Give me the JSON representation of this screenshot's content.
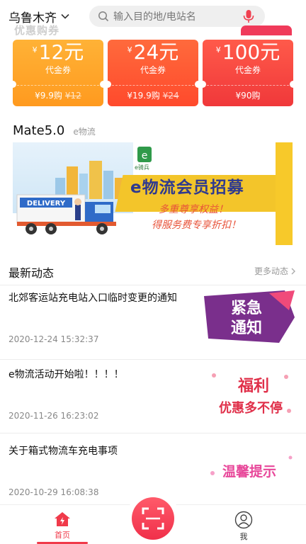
{
  "header": {
    "city": "乌鲁木齐",
    "search_placeholder": "输入目的地/电站名"
  },
  "coupons": {
    "section_title": "优惠购券",
    "items": [
      {
        "currency": "¥",
        "amount": "12元",
        "tag": "代金券",
        "price": "¥9.9购",
        "original_price": "¥12"
      },
      {
        "currency": "¥",
        "amount": "24元",
        "tag": "代金券",
        "price": "¥19.9购",
        "original_price": "¥24"
      },
      {
        "currency": "¥",
        "amount": "100元",
        "tag": "代金券",
        "price": "¥90购",
        "original_price": ""
      }
    ]
  },
  "mate": {
    "title": "Mate5.0",
    "subtitle": "e物流"
  },
  "banner": {
    "logo_text": "e骑兵",
    "headline": "e物流会员招募",
    "line1": "多重尊享权益！",
    "line2": "得服务费专享折扣！",
    "truck_label": "DELIVERY"
  },
  "news": {
    "title": "最新动态",
    "more_label": "更多动态",
    "items": [
      {
        "headline": "北郊客运站充电站入口临时变更的通知",
        "date": "2020-12-24 15:32:37",
        "thumb_text_1": "紧急",
        "thumb_text_2": "通知"
      },
      {
        "headline": "e物流活动开始啦！！！！",
        "date": "2020-11-26 16:23:02",
        "thumb_text_1": "福利",
        "thumb_text_2": "优惠多不停"
      },
      {
        "headline": "关于箱式物流车充电事项",
        "date": "2020-10-29 16:08:38",
        "thumb_text_1": "温馨提示",
        "thumb_text_2": ""
      }
    ]
  },
  "nav": {
    "home_label": "首页",
    "me_label": "我"
  },
  "colors": {
    "accent": "#f03a4a",
    "coupon_orange": "#ffa22a",
    "banner_yellow": "#f3c52a",
    "headline_blue": "#2f3a8f"
  }
}
